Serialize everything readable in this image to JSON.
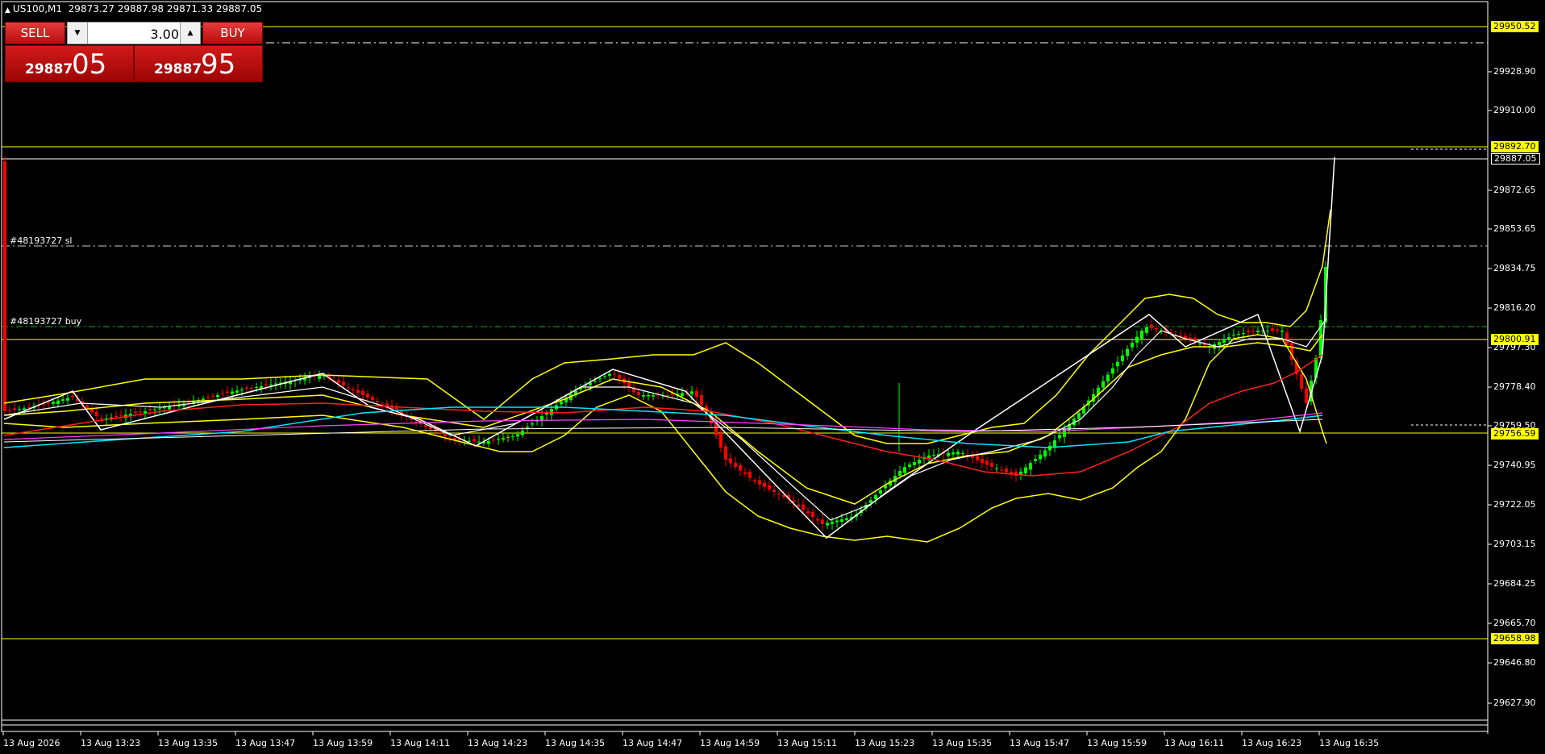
{
  "header": {
    "symbol": "US100,M1",
    "ohlc": "29873.27 29887.98 29871.33 29887.05"
  },
  "trade_panel": {
    "sell_label": "SELL",
    "buy_label": "BUY",
    "lot_value": "3.00",
    "bid_main": "29887",
    "bid_big": "05",
    "ask_main": "29887",
    "ask_big": "95"
  },
  "orders": {
    "sl_label": "#48193727 sl",
    "buy_label": "#48193727 buy"
  },
  "price_tags": {
    "t1": "29950.52",
    "t2": "29892.70",
    "t3": "29887.05",
    "t4": "29800.91",
    "t5": "29756.59",
    "t6": "29658.98"
  },
  "y_axis": [
    "29928.90",
    "29910.00",
    "29872.65",
    "29853.65",
    "29834.75",
    "29816.20",
    "29797.30",
    "29778.40",
    "29759.50",
    "29740.95",
    "29722.05",
    "29703.15",
    "29684.25",
    "29665.70",
    "29646.80",
    "29627.90"
  ],
  "x_axis": [
    "13 Aug 2026",
    "13 Aug 13:23",
    "13 Aug 13:35",
    "13 Aug 13:47",
    "13 Aug 13:59",
    "13 Aug 14:11",
    "13 Aug 14:23",
    "13 Aug 14:35",
    "13 Aug 14:47",
    "13 Aug 14:59",
    "13 Aug 15:11",
    "13 Aug 15:23",
    "13 Aug 15:35",
    "13 Aug 15:47",
    "13 Aug 15:59",
    "13 Aug 16:11",
    "13 Aug 16:23",
    "13 Aug 16:35"
  ],
  "colors": {
    "up": "#00ff00",
    "down": "#ff0000",
    "band": "#ffff00",
    "white": "#ffffff",
    "cyan": "#00e5ff",
    "magenta": "#ff44ff",
    "red_ma": "#ff2020",
    "order_line": "#00c000"
  }
}
